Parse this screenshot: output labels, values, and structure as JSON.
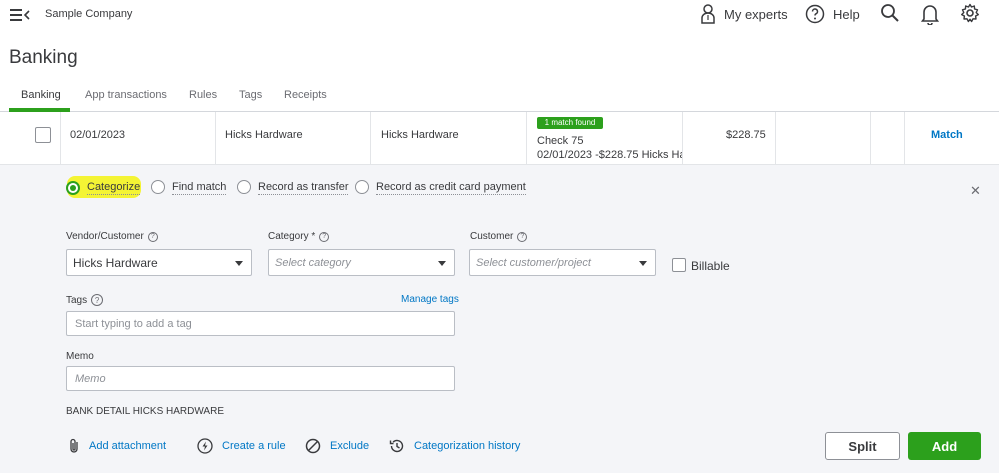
{
  "header": {
    "company": "Sample Company",
    "my_experts": "My experts",
    "help": "Help"
  },
  "page": {
    "title": "Banking"
  },
  "tabs": [
    {
      "label": "Banking",
      "active": true
    },
    {
      "label": "App transactions"
    },
    {
      "label": "Rules"
    },
    {
      "label": "Tags"
    },
    {
      "label": "Receipts"
    }
  ],
  "transaction": {
    "date": "02/01/2023",
    "description": "Hicks Hardware",
    "payee": "Hicks Hardware",
    "badge": "1 match found",
    "match_title": "Check 75",
    "match_detail": "02/01/2023 -$228.75 Hicks Ha",
    "amount": "$228.75",
    "action": "Match"
  },
  "options": {
    "categorize": "Categorize",
    "find_match": "Find match",
    "record_transfer": "Record as transfer",
    "record_cc": "Record as credit card payment",
    "selected": "Categorize"
  },
  "form": {
    "vendor_label": "Vendor/Customer",
    "vendor_value": "Hicks Hardware",
    "category_label": "Category *",
    "category_placeholder": "Select category",
    "customer_label": "Customer",
    "customer_placeholder": "Select customer/project",
    "billable_label": "Billable",
    "tags_label": "Tags",
    "manage_tags": "Manage tags",
    "tags_placeholder": "Start typing to add a tag",
    "memo_label": "Memo",
    "memo_placeholder": "Memo"
  },
  "bank_detail": {
    "label": "BANK DETAIL",
    "value": "HICKS HARDWARE"
  },
  "footer": {
    "add_attachment": "Add attachment",
    "create_rule": "Create a rule",
    "exclude": "Exclude",
    "history": "Categorization history",
    "split": "Split",
    "add": "Add"
  },
  "colors": {
    "accent": "#2ca01c",
    "link": "#0077c5",
    "highlight": "#f4f434",
    "panel": "#f4f5f8"
  }
}
